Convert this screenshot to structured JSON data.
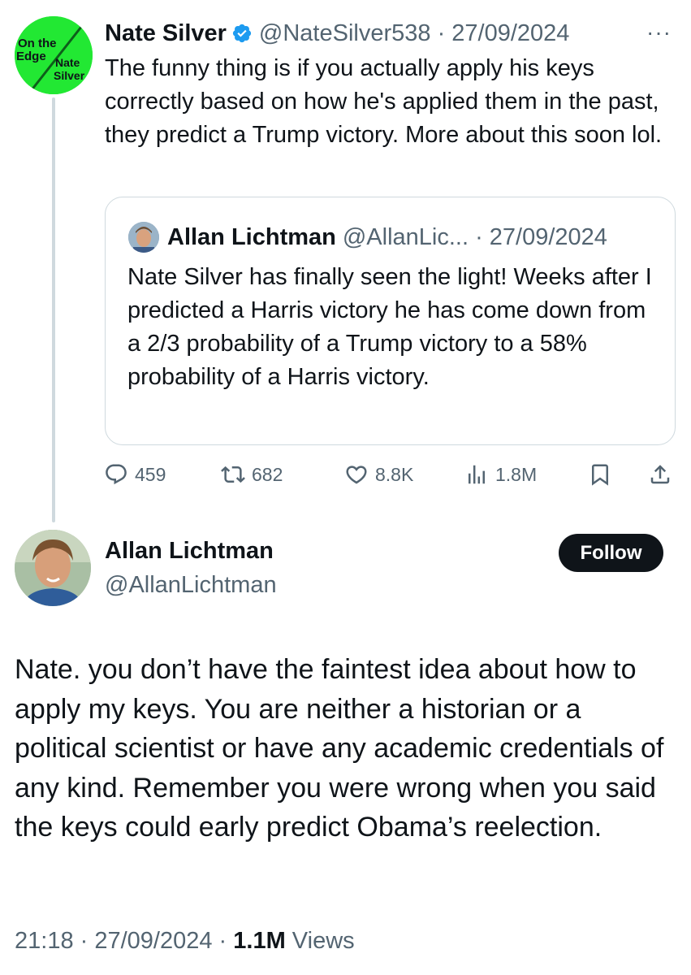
{
  "original_tweet": {
    "author_name": "Nate Silver",
    "handle_date": "@NateSilver538 · 27/09/2024",
    "more_glyph": "···",
    "avatar_text": {
      "line1": "On the",
      "line2": "Edge",
      "line3": "Nate",
      "line4": "Silver"
    },
    "body": "The funny thing is if you actually apply his keys correctly based on how he's applied them in the past, they predict a Trump victory. More about this soon lol.",
    "quoted": {
      "author_name": "Allan Lichtman",
      "handle_date": "@AllanLic... · 27/09/2024",
      "body": "Nate Silver has finally seen the light! Weeks after I predicted a Harris victory he has come down from a 2/3 probability of a Trump victory to a 58% probability of a Harris victory."
    },
    "actions": {
      "replies": "459",
      "reposts": "682",
      "likes": "8.8K",
      "views": "1.8M"
    }
  },
  "reply_tweet": {
    "author_name": "Allan Lichtman",
    "handle": "@AllanLichtman",
    "follow_label": "Follow",
    "body": "Nate. you don’t have the faintest idea about how to apply my keys. You are neither a historian or a political scientist or have any academic credentials of any kind. Remember you were wrong when you said the keys could early predict Obama’s reelection.",
    "time_date": "21:18 · 27/09/2024 · ",
    "views_count": "1.1M",
    "views_label": " Views"
  },
  "colors": {
    "accent_green": "#22e833",
    "verified_blue": "#1d9bf0",
    "muted_text": "#536471",
    "border": "#cfd9de"
  }
}
